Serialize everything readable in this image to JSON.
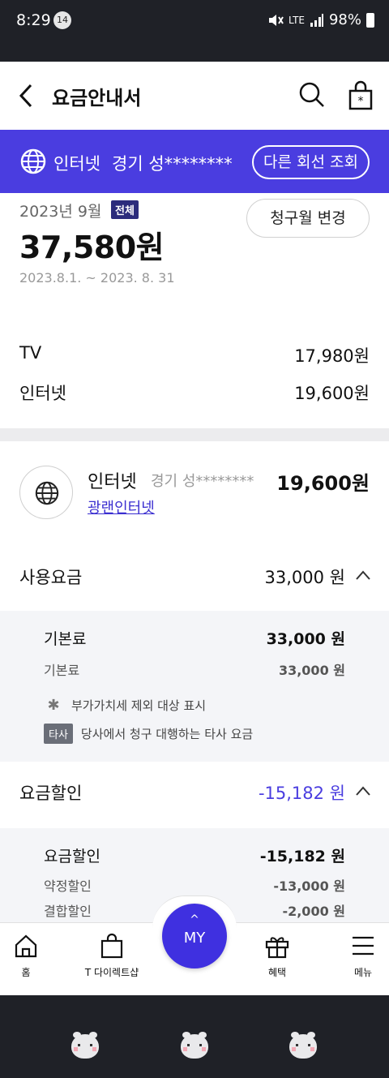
{
  "status_bar": {
    "time": "8:29",
    "notification_count": "14",
    "network": "LTE",
    "battery": "98%"
  },
  "header": {
    "title": "요금안내서"
  },
  "line_band": {
    "service": "인터넷",
    "customer": "경기 성********",
    "other_line_button": "다른 회선 조회"
  },
  "summary": {
    "month": "2023년 9월",
    "badge": "전체",
    "change_month_button": "청구월 변경",
    "total": "37,580원",
    "period": "2023.8.1. ~ 2023. 8. 31",
    "items": [
      {
        "label": "TV",
        "amount": "17,980원"
      },
      {
        "label": "인터넷",
        "amount": "19,600원"
      }
    ]
  },
  "detail": {
    "service": "인터넷",
    "customer": "경기 성********",
    "amount": "19,600원",
    "plan_link": "광랜인터넷"
  },
  "usage": {
    "label": "사용요금",
    "amount": "33,000 원",
    "main_label": "기본료",
    "main_amount": "33,000 원",
    "sub_label": "기본료",
    "sub_amount": "33,000 원",
    "note1": "부가가치세 제외 대상 표시",
    "note2_tag": "타사",
    "note2": "당사에서 청구 대행하는 타사 요금"
  },
  "discount": {
    "label": "요금할인",
    "amount": "-15,182 원",
    "main_label": "요금할인",
    "main_amount": "-15,182 원",
    "sub1_label": "약정할인",
    "sub1_amount": "-13,000 원",
    "sub2_label": "결합할인",
    "sub2_amount": "-2,000 원"
  },
  "bottom_nav": {
    "home": "홈",
    "shop": "T 다이렉트샵",
    "my": "MY",
    "benefit": "혜택",
    "menu": "메뉴"
  },
  "colors": {
    "accent": "#4a3de0",
    "discount_text": "#4a3de0"
  }
}
